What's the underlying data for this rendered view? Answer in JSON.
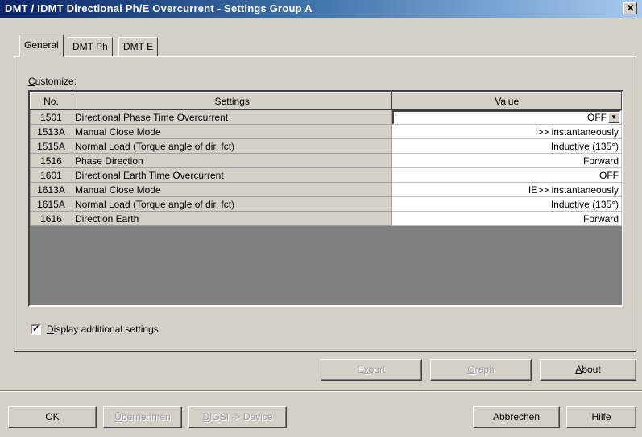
{
  "window": {
    "title": "DMT / IDMT Directional Ph/E Overcurrent - Settings Group A",
    "close_glyph": "✕"
  },
  "tabs": [
    {
      "label": "General",
      "active": true
    },
    {
      "label": "DMT Ph",
      "active": false
    },
    {
      "label": "DMT E",
      "active": false
    }
  ],
  "customize": {
    "accel": "C",
    "rest": "ustomize:"
  },
  "table": {
    "headers": {
      "no": "No.",
      "settings": "Settings",
      "value": "Value"
    },
    "rows": [
      {
        "no": "1501",
        "setting": "Directional Phase Time Overcurrent",
        "value": "OFF",
        "dropdown": true
      },
      {
        "no": "1513A",
        "setting": "Manual Close Mode",
        "value": "I>> instantaneously"
      },
      {
        "no": "1515A",
        "setting": "Normal Load (Torque angle of dir. fct)",
        "value": "Inductive (135°)"
      },
      {
        "no": "1516",
        "setting": "Phase Direction",
        "value": "Forward"
      },
      {
        "no": "1601",
        "setting": "Directional Earth Time Overcurrent",
        "value": "OFF"
      },
      {
        "no": "1613A",
        "setting": "Manual Close Mode",
        "value": "IE>> instantaneously"
      },
      {
        "no": "1615A",
        "setting": "Normal Load (Torque angle of dir. fct)",
        "value": "Inductive (135°)"
      },
      {
        "no": "1616",
        "setting": "Direction Earth",
        "value": "Forward"
      }
    ]
  },
  "display_additional": {
    "checked": true,
    "check_glyph": "✓",
    "accel": "D",
    "rest": "isplay additional settings"
  },
  "buttons": {
    "export": {
      "pre": "E",
      "accel": "x",
      "post": "port",
      "enabled": false
    },
    "graph": {
      "pre": "",
      "accel": "G",
      "post": "raph",
      "enabled": false
    },
    "about": {
      "pre": "",
      "accel": "A",
      "post": "bout",
      "enabled": true
    },
    "ok": {
      "label": "OK"
    },
    "uebernehmen": {
      "pre": "",
      "accel": "Ü",
      "post": "bernehmen",
      "enabled": false
    },
    "digsi": {
      "pre": "",
      "accel": "D",
      "post": "IGSI -> Device",
      "enabled": false
    },
    "abbrechen": {
      "label": "Abbrechen"
    },
    "hilfe": {
      "label": "Hilfe"
    }
  },
  "colors": {
    "face": "#d4d0c8",
    "title_start": "#0a246a",
    "title_end": "#a6caf0",
    "grid_empty": "#808080"
  }
}
